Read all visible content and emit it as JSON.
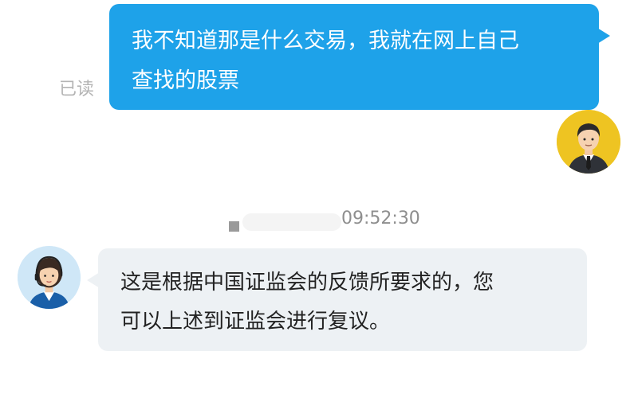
{
  "conversation": {
    "outgoing_message": {
      "lines": [
        "我不知道那是什么交易，我就在网上自己",
        "查找的股票"
      ],
      "read_status": "已读",
      "bubble_color": "#1ea2e9",
      "avatar_icon": "user-avatar-icon"
    },
    "timestamp": "09:52:30",
    "incoming_message": {
      "lines": [
        "这是根据中国证监会的反馈所要求的，您",
        "可以上述到证监会进行复议。"
      ],
      "bubble_color": "#edf1f4",
      "avatar_icon": "customer-service-avatar-icon"
    }
  }
}
